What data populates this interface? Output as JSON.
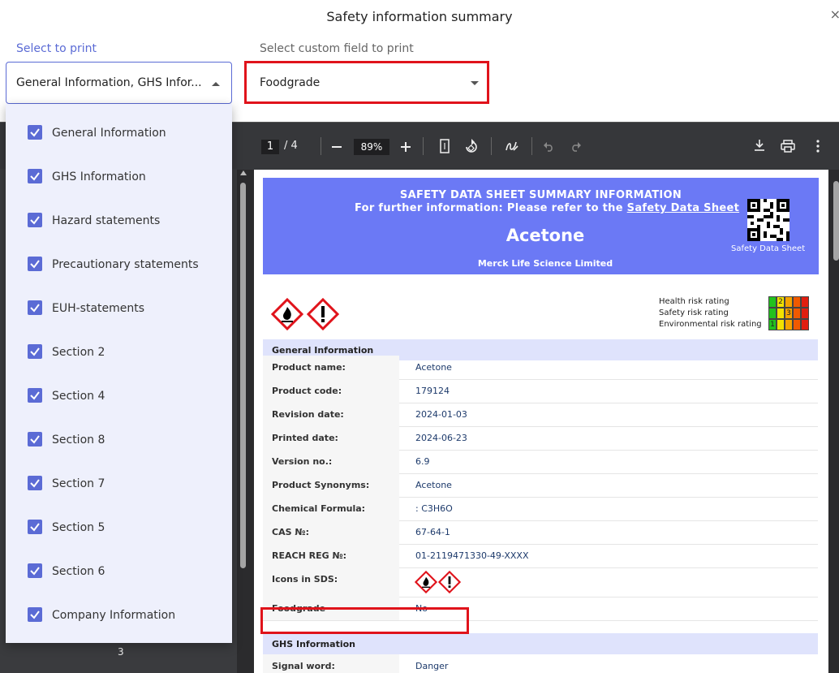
{
  "dialog": {
    "title": "Safety information summary",
    "close": "×"
  },
  "print_select": {
    "label": "Select to print",
    "value": "General Information, GHS Infor...",
    "options": [
      {
        "label": "General Information",
        "checked": true
      },
      {
        "label": "GHS Information",
        "checked": true
      },
      {
        "label": "Hazard statements",
        "checked": true
      },
      {
        "label": "Precautionary statements",
        "checked": true
      },
      {
        "label": "EUH-statements",
        "checked": true
      },
      {
        "label": "Section 2",
        "checked": true
      },
      {
        "label": "Section 4",
        "checked": true
      },
      {
        "label": "Section 8",
        "checked": true
      },
      {
        "label": "Section 7",
        "checked": true
      },
      {
        "label": "Section 5",
        "checked": true
      },
      {
        "label": "Section 6",
        "checked": true
      },
      {
        "label": "Company Information",
        "checked": true
      }
    ]
  },
  "custom_select": {
    "label": "Select custom field to print",
    "value": "Foodgrade"
  },
  "viewer": {
    "page_current": "1",
    "page_total": "/ 4",
    "zoom": "89%",
    "thumb_page": "3",
    "icons": [
      "zoom-out-icon",
      "zoom-in-icon",
      "fit-page-icon",
      "rotate-icon",
      "draw-icon",
      "undo-icon",
      "redo-icon",
      "download-icon",
      "print-icon",
      "more-icon"
    ]
  },
  "document": {
    "banner_line1": "SAFETY DATA SHEET SUMMARY INFORMATION",
    "banner_line2_prefix": "For further information: Please refer to the ",
    "banner_line2_link": "Safety Data Sheet",
    "product_title": "Acetone",
    "company": "Merck Life Science Limited",
    "qr_label": "Safety Data Sheet",
    "risk_labels": [
      "Health risk rating",
      "Safety risk rating",
      "Environmental risk rating"
    ],
    "risk_values": [
      "2",
      "3",
      "1"
    ],
    "risk_colors": [
      "#22c21e",
      "#f2e200",
      "#f5a300",
      "#f05a00",
      "#e01e10"
    ],
    "general_section": "General Information",
    "rows": [
      {
        "k": "Product name:",
        "v": "Acetone"
      },
      {
        "k": "Product code:",
        "v": "179124"
      },
      {
        "k": "Revision date:",
        "v": "2024-01-03"
      },
      {
        "k": "Printed date:",
        "v": "2024-06-23"
      },
      {
        "k": "Version no.:",
        "v": "6.9"
      },
      {
        "k": "Product Synonyms:",
        "v": "Acetone"
      },
      {
        "k": "Chemical Formula:",
        "v": ": C3H6O"
      },
      {
        "k": "CAS №:",
        "v": "67-64-1"
      },
      {
        "k": "REACH REG №:",
        "v": "01-2119471330-49-XXXX"
      },
      {
        "k": "Icons in SDS:",
        "v": ""
      },
      {
        "k": "Foodgrade",
        "v": "No"
      }
    ],
    "ghs_section": "GHS Information",
    "signal_row": {
      "k": "Signal word:",
      "v": "Danger"
    }
  }
}
